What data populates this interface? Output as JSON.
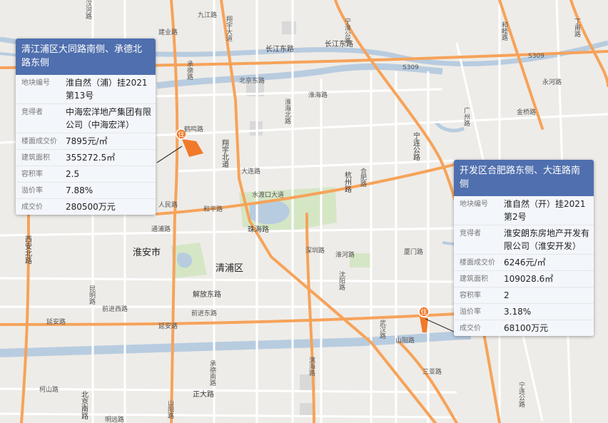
{
  "map": {
    "district_labels": {
      "huaian": "淮安市",
      "qingpu": "清浦区"
    },
    "road_labels": {
      "changjiang_dong": "长江东路",
      "changjiang_dong2": "长江东路",
      "s309": "S309",
      "s309b": "S309",
      "beijing_dong": "北京东路",
      "huaihai": "淮海路",
      "shuidukou": "水渡口大道",
      "zhuhai": "珠海路",
      "jiefang_dong": "解放东路",
      "qianjin_xi": "前进西路",
      "qianjin_dong": "前进东路",
      "yanan": "延安路",
      "yanan2": "延安路",
      "hangzhou": "杭州路",
      "xiangyu": "翔宇大道",
      "xiangyu_bei": "翔宇北道",
      "ningliankgong": "宁连公路",
      "ningliankgong2": "宁连公路",
      "ninghuai": "宁淮公路",
      "xihua": "西安北路",
      "beijing_nan": "北京南路",
      "zhengda": "正大路",
      "mingyuan": "明远路",
      "chengde": "承德南路",
      "chengde_bei": "承德路",
      "shenzhen": "深圳路",
      "dalian": "大连路",
      "hefei": "合肥路",
      "shenyang": "沈阳路",
      "xiamen": "厦门路",
      "sanya": "三亚路",
      "zhaoqing": "漓海路",
      "shanyang": "山阳路",
      "shanyang2": "山阳路",
      "tongpu": "通浦路",
      "helan": "和平路",
      "dunfang": "人民路",
      "yongzhou": "永河路",
      "hexie": "和睦路",
      "guangzhou": "广州路",
      "wuhan": "武汉路",
      "kunming": "昆明路",
      "ding": "丁甫路",
      "heqiao": "鹤鸣路",
      "jiuhe": "九江路",
      "jianye": "建业路",
      "shaanxi": "淮海北路",
      "huaihe": "淮河路",
      "jinqiao": "金桥路",
      "hanhe": "汉河路",
      "linyi": "柯山路"
    },
    "marker_labels": {
      "m1": "住",
      "m2": "住"
    }
  },
  "cards": [
    {
      "title": "清江浦区大同路南侧、承德北路东侧",
      "rows": [
        {
          "key": "地块编号",
          "value": "淮自然（浦）挂2021第13号"
        },
        {
          "key": "竞得者",
          "value": "中海宏洋地产集团有限公司（中海宏洋）"
        },
        {
          "key": "楼面成交价",
          "value": "7895元/㎡"
        },
        {
          "key": "建筑面积",
          "value": "355272.5㎡"
        },
        {
          "key": "容积率",
          "value": "2.5"
        },
        {
          "key": "溢价率",
          "value": "7.88%"
        },
        {
          "key": "成交价",
          "value": "280500万元"
        }
      ]
    },
    {
      "title": "开发区合肥路东侧、大连路南侧",
      "rows": [
        {
          "key": "地块编号",
          "value": "淮自然（开）挂2021第2号"
        },
        {
          "key": "竞得者",
          "value": "淮安朗东房地产开发有限公司（淮安开发）"
        },
        {
          "key": "楼面成交价",
          "value": "6246元/㎡"
        },
        {
          "key": "建筑面积",
          "value": "109028.6㎡"
        },
        {
          "key": "容积率",
          "value": "2"
        },
        {
          "key": "溢价率",
          "value": "3.18%"
        },
        {
          "key": "成交价",
          "value": "68100万元"
        }
      ]
    }
  ],
  "colors": {
    "background": "#eeece8",
    "water": "#b7cde0",
    "green": "#cfe3bf",
    "major_road": "#f6a35a",
    "minor_road": "#ffffff",
    "card_header": "#4f6fae",
    "marker": "#f07a2a"
  }
}
